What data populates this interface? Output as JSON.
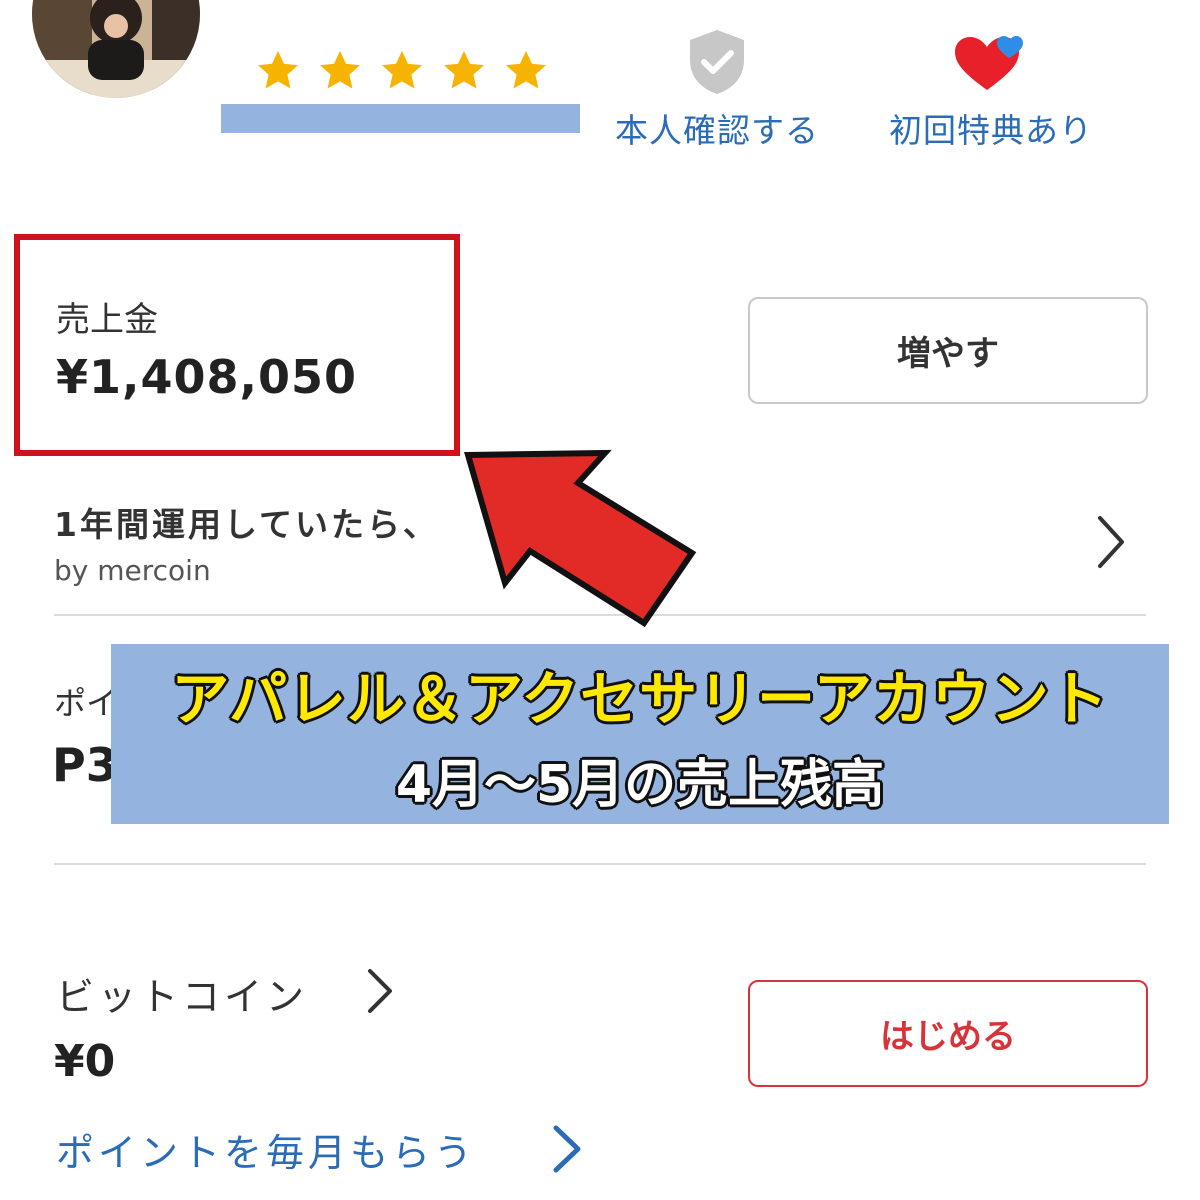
{
  "profile": {
    "rating_stars": 5,
    "badges": [
      {
        "icon": "shield-check-icon",
        "label": "本人確認する"
      },
      {
        "icon": "heart-icon",
        "label": "初回特典あり"
      }
    ]
  },
  "sales": {
    "label": "売上金",
    "amount": "¥1,408,050",
    "increase_button": "増やす"
  },
  "invest": {
    "title": "1年間運用していたら、",
    "subtitle": "by mercoin"
  },
  "points": {
    "label_visible": "ポイ",
    "amount_visible": "P3"
  },
  "overlay": {
    "line1": "アパレル＆アクセサリーアカウント",
    "line2": "4月〜5月の売上残高"
  },
  "bitcoin": {
    "label": "ビットコイン",
    "amount": "¥0",
    "start_button": "はじめる"
  },
  "monthly_points_link": "ポイントを毎月もらう",
  "colors": {
    "star": "#f6b400",
    "link_blue": "#2a6cb7",
    "highlight_red": "#d0121b",
    "banner_blue": "#95b3df",
    "banner_yellow": "#ffe900"
  }
}
